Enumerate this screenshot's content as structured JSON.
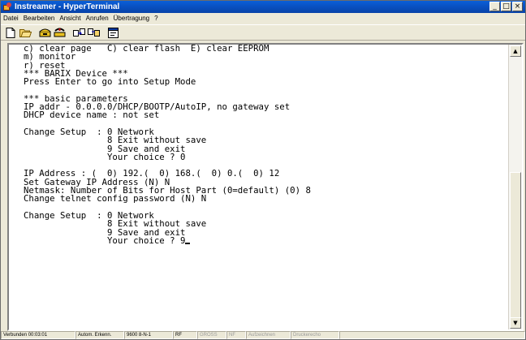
{
  "window": {
    "title": "Instreamer - HyperTerminal"
  },
  "menu": [
    "Datei",
    "Bearbeiten",
    "Ansicht",
    "Anrufen",
    "Übertragung",
    "?"
  ],
  "toolbar": {
    "icons": [
      "new-document-icon",
      "open-folder-icon",
      "connect-phone-icon",
      "disconnect-phone-icon",
      "send-file-icon",
      "receive-file-icon",
      "properties-icon"
    ]
  },
  "terminal": {
    "lines": [
      "c) clear page   C) clear flash  E) clear EEPROM",
      "m) monitor",
      "r) reset",
      "*** BARIX Device ***",
      "Press Enter to go into Setup Mode",
      "",
      "*** basic parameters",
      "IP addr - 0.0.0.0/DHCP/BOOTP/AutoIP, no gateway set",
      "DHCP device name : not set",
      "",
      "Change Setup  : 0 Network",
      "                8 Exit without save",
      "                9 Save and exit",
      "                Your choice ? 0",
      "",
      "IP Address : (  0) 192.(  0) 168.(  0) 0.(  0) 12",
      "Set Gateway IP Address (N) N",
      "Netmask: Number of Bits for Host Part (0=default) (0) 8",
      "Change telnet config password (N) N",
      "",
      "Change Setup  : 0 Network",
      "                8 Exit without save",
      "                9 Save and exit",
      "                Your choice ? 9"
    ]
  },
  "status": {
    "connected": "Verbunden 00:03:01",
    "detection": "Autom. Erkenn.",
    "settings": "9600 8-N-1",
    "scroll": "RF",
    "caps": "GROSS",
    "num": "NF",
    "capture": "Aufzeichnen",
    "echo": "Druckerecho"
  }
}
